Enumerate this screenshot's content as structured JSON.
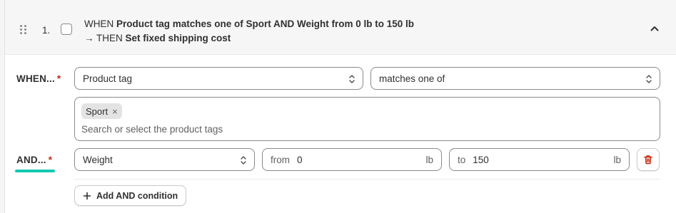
{
  "rule": {
    "number": "1.",
    "summary_when_prefix": "WHEN ",
    "summary_when_bold": "Product tag matches one of Sport AND Weight from 0 lb to 150 lb",
    "summary_then_prefix": "→ THEN ",
    "summary_then_bold": "Set fixed shipping cost"
  },
  "when_row": {
    "label": "WHEN...",
    "required_mark": "*",
    "field_select": "Product tag",
    "operator_select": "matches one of",
    "tags": [
      "Sport"
    ],
    "tag_remove_glyph": "×",
    "tags_placeholder": "Search or select the product tags"
  },
  "and_row": {
    "label": "AND...",
    "required_mark": "*",
    "field_select": "Weight",
    "from_prefix": "from",
    "from_value": "0",
    "from_unit": "lb",
    "to_prefix": "to",
    "to_value": "150",
    "to_unit": "lb"
  },
  "add_condition": {
    "label": "Add AND condition",
    "icon": "plus-icon"
  },
  "colors": {
    "accent_underline": "#14c9b0",
    "required": "#c5280c",
    "delete_icon": "#c5280c"
  }
}
